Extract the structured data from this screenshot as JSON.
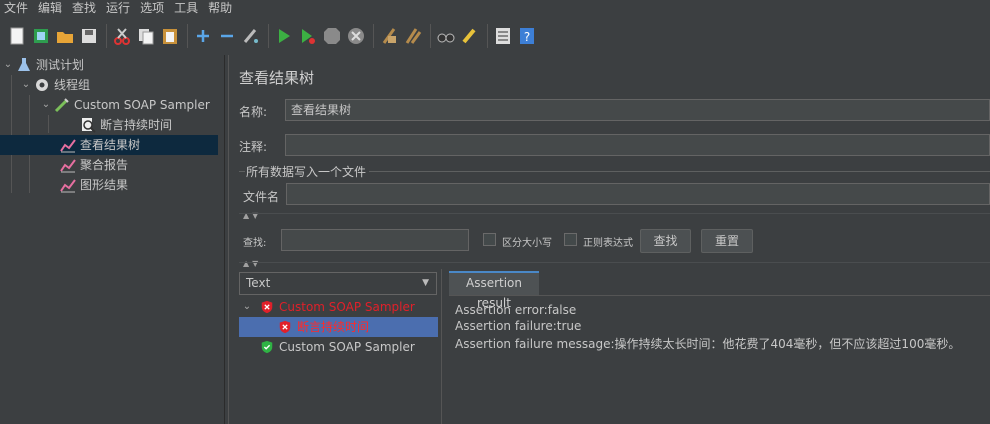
{
  "menu": [
    "文件",
    "编辑",
    "查找",
    "运行",
    "选项",
    "工具",
    "帮助"
  ],
  "tree": {
    "root": "测试计划",
    "thread_group": "线程组",
    "sampler": "Custom SOAP Sampler",
    "assertion": "断言持续时间",
    "view_results": "查看结果树",
    "aggregate": "聚合报告",
    "graph": "图形结果"
  },
  "panel": {
    "title": "查看结果树",
    "name_label": "名称:",
    "name_value": "查看结果树",
    "comment_label": "注释:",
    "comment_value": "",
    "group_title": "所有数据写入一个文件",
    "file_label": "文件名",
    "file_value": "",
    "search_label": "查找:",
    "search_value": "",
    "case_label": "区分大小写",
    "regex_label": "正则表达式",
    "search_button": "查找",
    "reset_button": "重置",
    "renderer": "Text"
  },
  "results": [
    {
      "label": "Custom SOAP Sampler",
      "status": "fail"
    },
    {
      "label": "断言持续时间",
      "status": "fail"
    },
    {
      "label": "Custom SOAP Sampler",
      "status": "ok"
    }
  ],
  "tab": "Assertion result",
  "assertion": {
    "line1": "Assertion error:false",
    "line2": "Assertion failure:true",
    "line3": "Assertion failure message:操作持续太长时间：他花费了404毫秒，但不应该超过100毫秒。"
  },
  "colors": {
    "fail": "#e0202a",
    "ok": "#2fb344",
    "selection": "#4b6eaf",
    "tree_selection": "#0d293e"
  }
}
